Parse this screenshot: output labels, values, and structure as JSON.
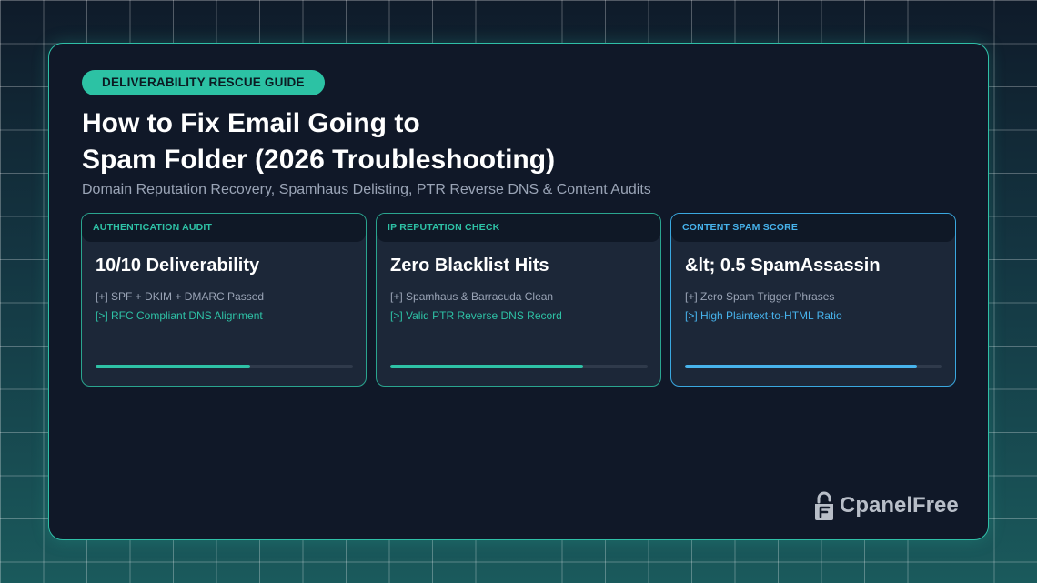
{
  "badge": "DELIVERABILITY RESCUE GUIDE",
  "title_line1": "How to Fix Email Going to",
  "title_line2": "Spam Folder (2026 Troubleshooting)",
  "subtitle": "Domain Reputation Recovery, Spamhaus Delisting, PTR Reverse DNS & Content Audits",
  "tiles": [
    {
      "header": "AUTHENTICATION AUDIT",
      "metric": "10/10 Deliverability",
      "line1": "[+] SPF + DKIM + DMARC Passed",
      "line2": "[>] RFC Compliant DNS Alignment",
      "progress": 0.6,
      "accent": "#2ec2a6"
    },
    {
      "header": "IP REPUTATION CHECK",
      "metric": "Zero Blacklist Hits",
      "line1": "[+] Spamhaus & Barracuda Clean",
      "line2": "[>] Valid PTR Reverse DNS Record",
      "progress": 0.75,
      "accent": "#2ec2a6"
    },
    {
      "header": "CONTENT SPAM SCORE",
      "metric": "&lt; 0.5 SpamAssassin",
      "line1": "[+] Zero Spam Trigger Phrases",
      "line2": "[>] High Plaintext-to-HTML Ratio",
      "progress": 0.9,
      "accent": "#47b3ec"
    }
  ],
  "brand": {
    "name": "CpanelFree",
    "icon": "cpanelfree-logo-icon"
  },
  "colors": {
    "card_border": "#2fbfa7",
    "badge_bg": "#2cc2a4",
    "card_bg": "#101828"
  }
}
